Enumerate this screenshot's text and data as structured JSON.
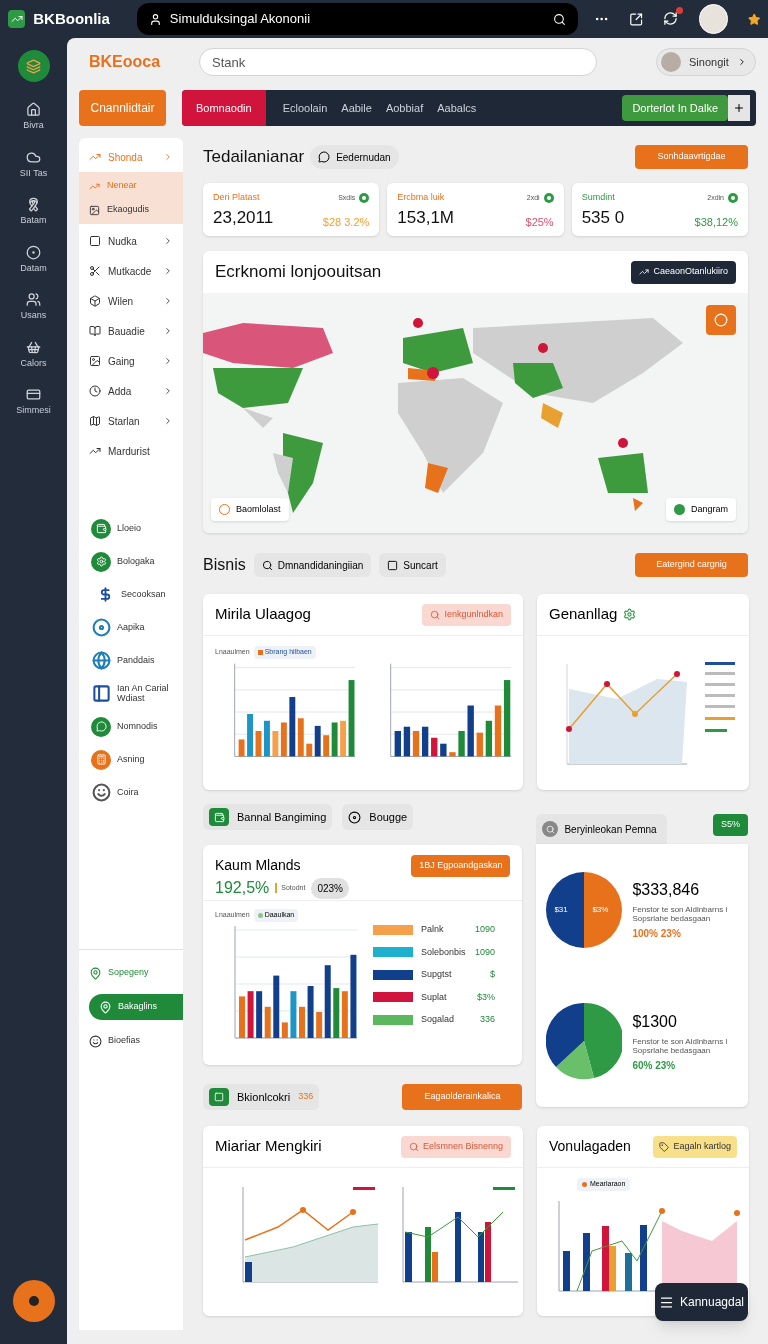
{
  "top_bar": {
    "app_name": "BKBoonlia",
    "search_value": "Simulduksingal Akononii"
  },
  "rail": {
    "items": [
      {
        "label": "Bivra"
      },
      {
        "label": "SII Tas"
      },
      {
        "label": "Batam"
      },
      {
        "label": "Datam"
      },
      {
        "label": "Usans"
      },
      {
        "label": "Calors"
      },
      {
        "label": "Simmesi"
      }
    ]
  },
  "header": {
    "logo": "BKEooca",
    "search_placeholder": "Stank",
    "user_name": "Sinongit"
  },
  "toolbar": {
    "primary_button": "Cnannlidtair",
    "tabs": [
      {
        "label": "Bomnaodin",
        "selected": true
      },
      {
        "label": "Ecloolain",
        "selected": false
      },
      {
        "label": "Aabile",
        "selected": false
      },
      {
        "label": "Aobbiaf",
        "selected": false
      },
      {
        "label": "Aabalcs",
        "selected": false
      }
    ],
    "action_button": "Dorterlot In Dalke"
  },
  "sidebar": {
    "nav": [
      {
        "label": "Shonda",
        "expandable": true,
        "expanded": true,
        "children": [
          {
            "label": "Nenear",
            "selected": true
          },
          {
            "label": "Ekaogudis",
            "selected": false
          }
        ]
      },
      {
        "label": "Nudka",
        "expandable": true,
        "expanded": false
      },
      {
        "label": "Mutkacde",
        "expandable": true,
        "expanded": false
      },
      {
        "label": "Wilen",
        "expandable": true,
        "expanded": false
      },
      {
        "label": "Bauadie",
        "expandable": true,
        "expanded": false
      },
      {
        "label": "Gaing",
        "expandable": true,
        "expanded": false
      },
      {
        "label": "Adda",
        "expandable": true,
        "expanded": false
      },
      {
        "label": "Starlan",
        "expandable": true,
        "expanded": false
      },
      {
        "label": "Mardurist",
        "expandable": false,
        "expanded": false
      }
    ],
    "apps": [
      {
        "label": "Lloeio",
        "kind": "filled",
        "color": "#1f8a3a"
      },
      {
        "label": "Bologaka",
        "kind": "filled",
        "color": "#1f8a3a"
      },
      {
        "label": "Secooksan",
        "kind": "glyph",
        "color": "#1e4f9c"
      },
      {
        "label": "Aapika",
        "kind": "outline",
        "color": "#1f7fb8"
      },
      {
        "label": "Panddais",
        "kind": "outline",
        "color": "#1f7fb8"
      },
      {
        "label": "Ian An Carial Wdiast",
        "kind": "outline",
        "color": "#1e4f9c"
      },
      {
        "label": "Nomnodis",
        "kind": "filled",
        "color": "#1f8a3a"
      },
      {
        "label": "Asning",
        "kind": "filled",
        "color": "#e8711c"
      },
      {
        "label": "Coira",
        "kind": "outline",
        "color": "#555555"
      }
    ],
    "footer": [
      {
        "label": "Sopegeny",
        "selected": false
      },
      {
        "label": "Bakaglins",
        "selected": true
      },
      {
        "label": "Bioefias",
        "selected": false
      }
    ]
  },
  "overview": {
    "title": "Tedailanianar",
    "chip": "Eedernudan",
    "button": "Sonhdaavrtigdae",
    "stats": [
      {
        "label": "Deri Platast",
        "positive": false,
        "period": "Sxdis",
        "value": "23,2011",
        "change": "$28 3.2%",
        "color": "#f0a030"
      },
      {
        "label": "Ercbma luik",
        "positive": false,
        "period": "2xdi",
        "value": "153,1M",
        "change": "$25%",
        "color": "#e05070"
      },
      {
        "label": "Sumdint",
        "positive": true,
        "period": "2xdin",
        "value": "535 0",
        "change": "$38,12%",
        "color": "#2e9a45"
      }
    ]
  },
  "map_card": {
    "title": "Ecrknomi lonjoouitsan",
    "button": "CaeaonOtanlukiiro",
    "legend_left": "Baomlolast",
    "legend_right": "Dangram"
  },
  "business": {
    "title": "Bisnis",
    "chips": [
      "Dmnandidaningiian",
      "Suncart"
    ],
    "button": "Eatergind cargnig"
  },
  "usage_card": {
    "title": "Mirila Ulaagog",
    "button": "Ienkgunlndkan",
    "legend_label": "Lnaaulmen",
    "legend_item": "Sbrang hilbaen"
  },
  "growth_card": {
    "title": "Genanllag"
  },
  "filters": {
    "chips": [
      "Bannal Bangiming",
      "Bougge"
    ]
  },
  "revenue_card": {
    "title": "Kaum Mlands",
    "value": "192,5%",
    "sub_label": "Sotodnt",
    "badge": "023%",
    "button": "1BJ Egpoandgaskan",
    "legend_label": "Lnaaulmen",
    "legend_item": "Daaulkan",
    "series": [
      {
        "name": "Palnk",
        "value": "1090",
        "color": "#f5a04a"
      },
      {
        "name": "Solebonbis",
        "value": "1090",
        "color": "#1eb0cc"
      },
      {
        "name": "Supgtst",
        "value": "$",
        "color": "#123f8c"
      },
      {
        "name": "Suplat",
        "value": "$3%",
        "color": "#d0143c"
      },
      {
        "name": "Sogalad",
        "value": "336",
        "color": "#5cb85c"
      }
    ]
  },
  "distribution": {
    "title": "Beryinleokan Pemna",
    "badge": "S5%",
    "pies": [
      {
        "value": "$333,846",
        "caption": "Fenstor te son Aldlnbarns ≀ Sopsrlahe bedasgaan",
        "change": "100% 23%",
        "color": "#e8711c",
        "slice_labels": [
          "$31",
          "$3%"
        ]
      },
      {
        "value": "$1300",
        "caption": "Fenstor te son Aldlnbarns ≀ Sopsrlahe bedasgaan",
        "change": "60% 23%",
        "color": "#2e9a45"
      }
    ]
  },
  "summary": {
    "chip": "Bkionlcokri",
    "chip_count": "336",
    "button": "Eagaolderainkalica"
  },
  "trend_card": {
    "title": "Miariar Mengkiri",
    "button": "Eelsmnen Bisnenng"
  },
  "volume_card": {
    "title": "Vonulagaden",
    "button": "Eagaln kartlog",
    "legend_item": "Mearlaraon"
  },
  "fab": {
    "label": "Kannuagdal"
  }
}
